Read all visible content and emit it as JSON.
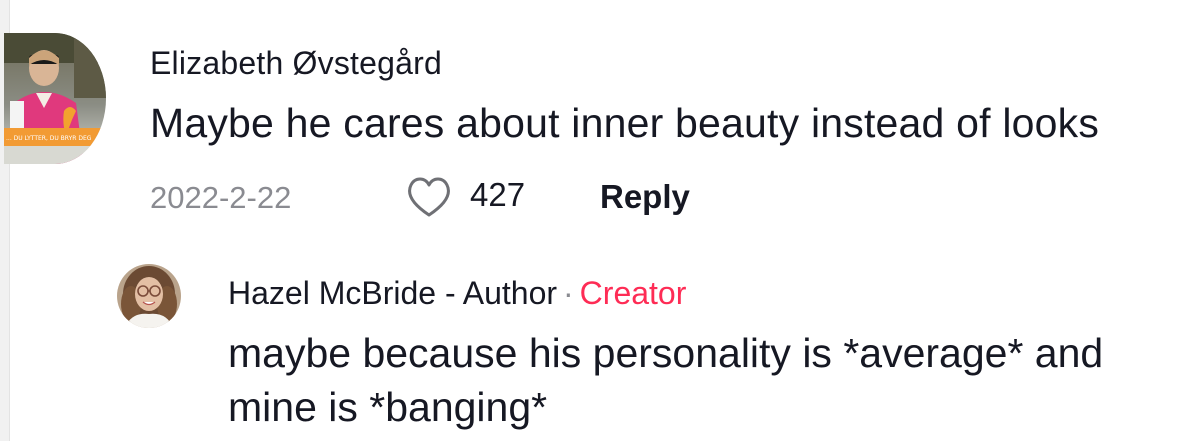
{
  "comment": {
    "username": "Elizabeth Øvstegård",
    "text": "Maybe he cares about inner beauty instead of looks",
    "date": "2022-2-22",
    "like_count": "427",
    "reply_label": "Reply",
    "avatar_icon": "profile-photo",
    "avatar_caption": "... DU LYTTER, DU BRYR DEG"
  },
  "reply": {
    "username": "Hazel McBride - Author",
    "separator": "·",
    "badge": "Creator",
    "text": "maybe because his personality is *average* and mine is *banging*",
    "avatar_icon": "profile-photo"
  },
  "colors": {
    "text_primary": "#161823",
    "text_secondary": "#8a8b91",
    "creator_badge": "#fe2c55",
    "background": "#ffffff"
  },
  "icons": {
    "like": "heart-outline-icon"
  }
}
